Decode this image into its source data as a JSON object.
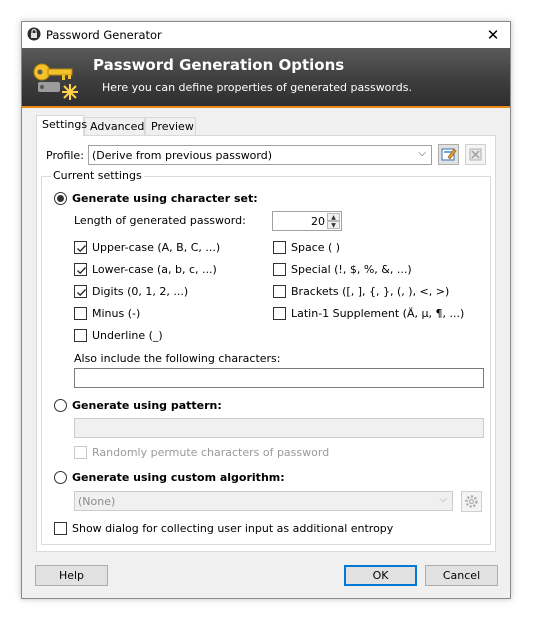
{
  "window": {
    "title": "Password Generator",
    "close_glyph": "✕"
  },
  "banner": {
    "title": "Password Generation Options",
    "subtitle": "Here you can define properties of generated passwords."
  },
  "tabs": [
    "Settings",
    "Advanced",
    "Preview"
  ],
  "profile": {
    "label": "Profile:",
    "value": "(Derive from previous password)"
  },
  "current_settings_label": "Current settings",
  "charset": {
    "label": "Generate using character set:",
    "length_label": "Length of generated password:",
    "length_value": "20",
    "options": {
      "uppercase": {
        "label": "Upper-case (A, B, C, ...)",
        "checked": true
      },
      "lowercase": {
        "label": "Lower-case (a, b, c, ...)",
        "checked": true
      },
      "digits": {
        "label": "Digits (0, 1, 2, ...)",
        "checked": true
      },
      "minus": {
        "label": "Minus (-)",
        "checked": false
      },
      "underline": {
        "label": "Underline (_)",
        "checked": false
      },
      "space": {
        "label": "Space ( )",
        "checked": false
      },
      "special": {
        "label": "Special (!, $, %, &, ...)",
        "checked": false
      },
      "brackets": {
        "label": "Brackets ([, ], {, }, (, ), <, >)",
        "checked": false
      },
      "latin1": {
        "label": "Latin-1 Supplement (Ä, µ, ¶, ...)",
        "checked": false
      }
    },
    "also_include_label": "Also include the following characters:",
    "also_include_value": ""
  },
  "pattern": {
    "label": "Generate using pattern:",
    "value": "",
    "permute_label": "Randomly permute characters of password"
  },
  "custom": {
    "label": "Generate using custom algorithm:",
    "value": "(None)"
  },
  "entropy_label": "Show dialog for collecting user input as additional entropy",
  "buttons": {
    "help": "Help",
    "ok": "OK",
    "cancel": "Cancel"
  },
  "icons": {
    "app": "lock-icon",
    "banner": "keys-icon",
    "save_profile": "save-profile-icon",
    "delete_profile": "delete-profile-icon",
    "custom_options": "gear-icon"
  },
  "colors": {
    "banner_accent": "#e98a18",
    "default_button_border": "#0078d7"
  }
}
